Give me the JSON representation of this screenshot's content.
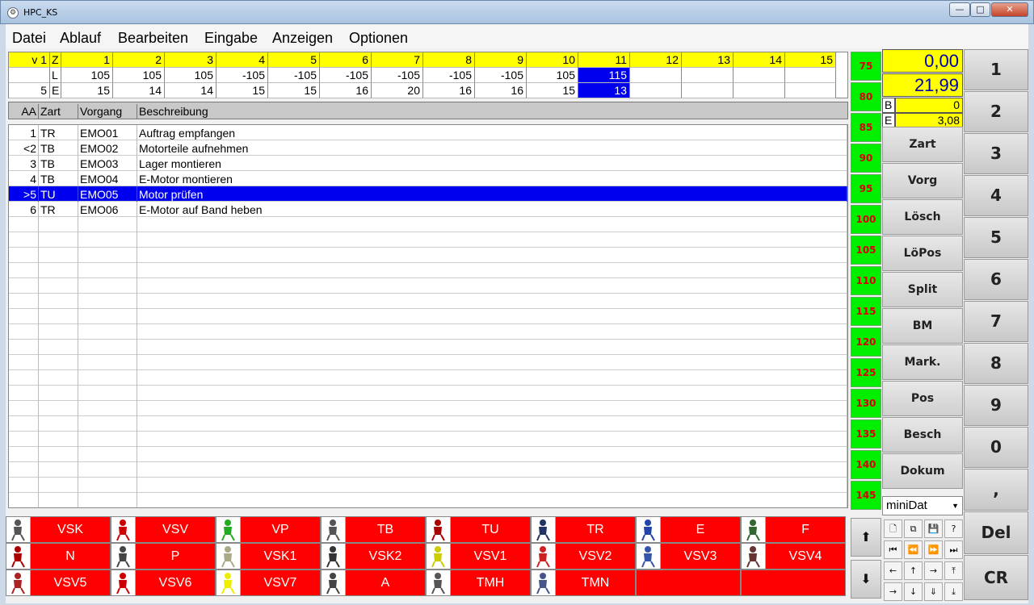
{
  "window": {
    "title": "HPC_KS",
    "min_label": "—",
    "max_label": "□",
    "close_label": "✕"
  },
  "menu": [
    "Datei",
    "Ablauf",
    "Bearbeiten",
    "Eingabe",
    "Anzeigen",
    "Optionen"
  ],
  "topgrid": {
    "header": [
      "v 1",
      "Z",
      "1",
      "2",
      "3",
      "4",
      "5",
      "6",
      "7",
      "8",
      "9",
      "10",
      "11",
      "12",
      "13",
      "14",
      "15"
    ],
    "row_l": [
      "",
      "L",
      "105",
      "105",
      "105",
      "-105",
      "-105",
      "-105",
      "-105",
      "-105",
      "-105",
      "105",
      "115",
      "",
      "",
      "",
      ""
    ],
    "row_e": [
      "5",
      "E",
      "15",
      "14",
      "14",
      "15",
      "15",
      "16",
      "20",
      "16",
      "16",
      "15",
      "13",
      "",
      "",
      "",
      ""
    ],
    "selected_col": 12
  },
  "columns": {
    "aa": "AA",
    "zart": "Zart",
    "vorgang": "Vorgang",
    "beschreibung": "Beschreibung"
  },
  "operations": [
    {
      "aa": "1",
      "zart": "TR",
      "vorgang": "EMO01",
      "beschreibung": "Auftrag empfangen"
    },
    {
      "aa": "<2",
      "zart": "TB",
      "vorgang": "EMO02",
      "beschreibung": "Motorteile aufnehmen"
    },
    {
      "aa": "3",
      "zart": "TB",
      "vorgang": "EMO03",
      "beschreibung": "Lager montieren"
    },
    {
      "aa": "4",
      "zart": "TB",
      "vorgang": "EMO04",
      "beschreibung": "E-Motor montieren"
    },
    {
      "aa": ">5",
      "zart": "TU",
      "vorgang": "EMO05",
      "beschreibung": "Motor prüfen"
    },
    {
      "aa": "6",
      "zart": "TR",
      "vorgang": "EMO06",
      "beschreibung": "E-Motor auf Band heben"
    }
  ],
  "selected_operation": 4,
  "scale": [
    "75",
    "80",
    "85",
    "90",
    "95",
    "100",
    "105",
    "110",
    "115",
    "120",
    "125",
    "130",
    "135",
    "140",
    "145"
  ],
  "display": {
    "value1": "0,00",
    "value2": "21,99",
    "b_label": "B",
    "b_value": "0",
    "e_label": "E",
    "e_value": "3,08"
  },
  "actions": [
    "Zart",
    "Vorg",
    "Lösch",
    "LöPos",
    "Split",
    "BM",
    "Mark.",
    "Pos",
    "Besch",
    "Dokum"
  ],
  "minidat": "miniDat",
  "keypad": [
    "1",
    "2",
    "3",
    "4",
    "5",
    "6",
    "7",
    "8",
    "9",
    "0",
    ",",
    "Del",
    "CR"
  ],
  "opbuttons": [
    {
      "label": "VSK",
      "icon": "reach-icon"
    },
    {
      "label": "VSV",
      "icon": "question-icon"
    },
    {
      "label": "VP",
      "icon": "bottle-icon"
    },
    {
      "label": "TB",
      "icon": "assemble-icon"
    },
    {
      "label": "TU",
      "icon": "inspect-icon"
    },
    {
      "label": "TR",
      "icon": "transport-icon"
    },
    {
      "label": "E",
      "icon": "sitting-worker-icon"
    },
    {
      "label": "F",
      "icon": "walking-worker-icon"
    },
    {
      "label": "N",
      "icon": "carry-icon"
    },
    {
      "label": "P",
      "icon": "person-icon"
    },
    {
      "label": "VSK1",
      "icon": "broom-icon"
    },
    {
      "label": "VSK2",
      "icon": "tools-icon"
    },
    {
      "label": "VSV1",
      "icon": "hand-tool-icon"
    },
    {
      "label": "VSV2",
      "icon": "lifting-icon"
    },
    {
      "label": "VSV3",
      "icon": "wrench-icon"
    },
    {
      "label": "VSV4",
      "icon": "pole-icon"
    },
    {
      "label": "VSV5",
      "icon": "meeting-icon"
    },
    {
      "label": "VSV6",
      "icon": "transfer-icon"
    },
    {
      "label": "VSV7",
      "icon": "pointing-hand-icon"
    },
    {
      "label": "A",
      "icon": "worker-icon"
    },
    {
      "label": "TMH",
      "icon": "drill-icon"
    },
    {
      "label": "TMN",
      "icon": "machine-icon"
    },
    {
      "label": "",
      "icon": ""
    },
    {
      "label": "",
      "icon": ""
    }
  ],
  "nav": [
    "new-doc-icon",
    "copy-doc-icon",
    "save-icon",
    "help-icon",
    "first-icon",
    "prev-icon",
    "next-icon",
    "last-icon",
    "left-icon",
    "up-icon",
    "right-icon",
    "top-icon",
    "right-icon",
    "down-icon",
    "down2-icon",
    "bottom-icon"
  ],
  "colors": {
    "yellow": "#ffff00",
    "selection": "#0000ee",
    "scale_bg": "#00ee00",
    "scale_text": "#dd0000",
    "op_button": "#ff0000"
  }
}
